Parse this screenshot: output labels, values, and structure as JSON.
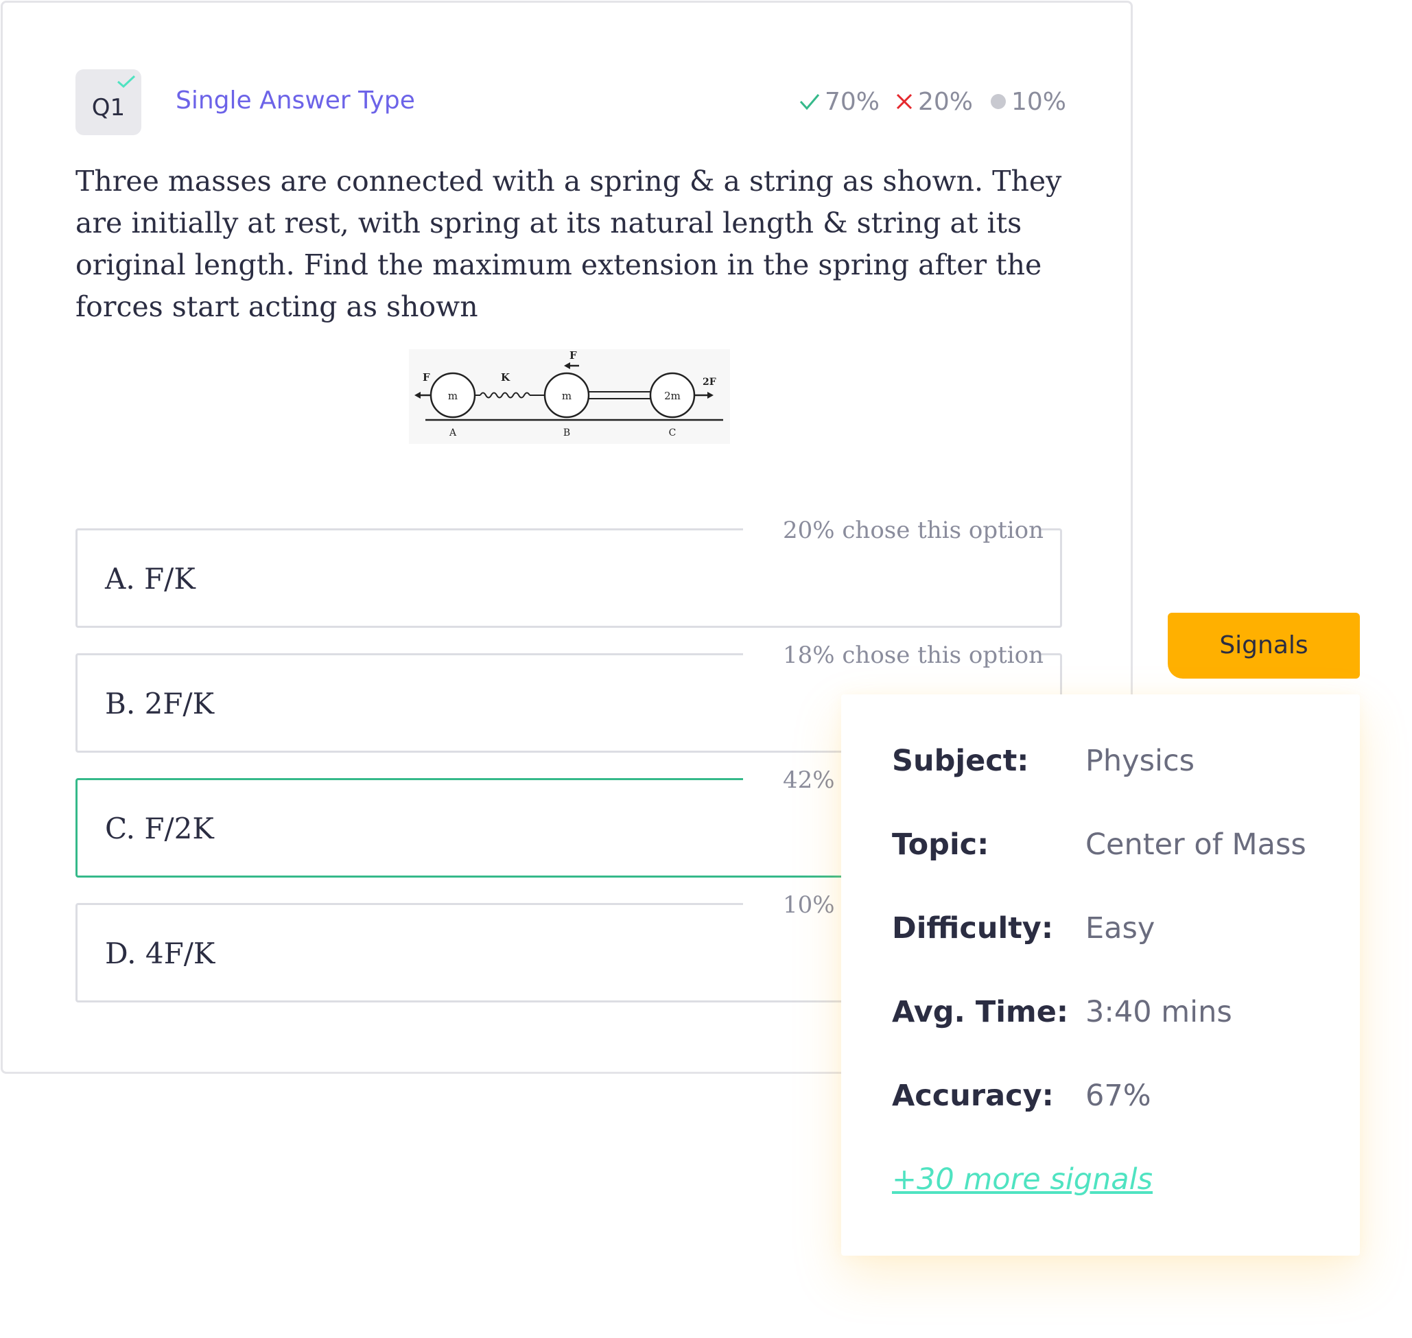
{
  "question": {
    "number": "Q1",
    "type": "Single Answer Type",
    "stats": {
      "correct": "70%",
      "incorrect": "20%",
      "skipped": "10%"
    },
    "text": "Three masses are connected with a spring & a string as shown. They are initially at rest, with spring at its natural length & string at its original length. Find the maximum extension in the spring after the forces start acting as shown",
    "diagram": {
      "force_left": "F",
      "force_top": "F",
      "force_right": "2F",
      "spring": "K",
      "mass_a": "m",
      "mass_b": "m",
      "mass_c": "2m",
      "label_a": "A",
      "label_b": "B",
      "label_c": "C"
    },
    "options": [
      {
        "label": "A. F/K",
        "share": "20% chose this option",
        "correct": false
      },
      {
        "label": "B. 2F/K",
        "share": "18% chose this option",
        "correct": false
      },
      {
        "label": "C. F/2K",
        "share": "42% chose this option",
        "correct": true
      },
      {
        "label": "D. 4F/K",
        "share": "10% chose this option",
        "correct": false
      }
    ]
  },
  "signals": {
    "tab_label": "Signals",
    "rows": [
      {
        "key": "Subject:",
        "value": "Physics"
      },
      {
        "key": "Topic:",
        "value": "Center of Mass"
      },
      {
        "key": "Difficulty:",
        "value": "Easy"
      },
      {
        "key": "Avg. Time:",
        "value": "3:40 mins"
      },
      {
        "key": "Accuracy:",
        "value": "67%"
      }
    ],
    "more_link": "+30 more signals"
  },
  "colors": {
    "accent_purple": "#6c63e8",
    "correct_green": "#35b98a",
    "incorrect_red": "#e5282d",
    "skipped_gray": "#c8c9d0",
    "signals_orange": "#ffb000",
    "link_teal": "#4fe3c1"
  },
  "icons": {
    "badge_check": "check-icon",
    "correct": "check-icon",
    "incorrect": "cross-icon",
    "skipped": "dot-icon"
  }
}
